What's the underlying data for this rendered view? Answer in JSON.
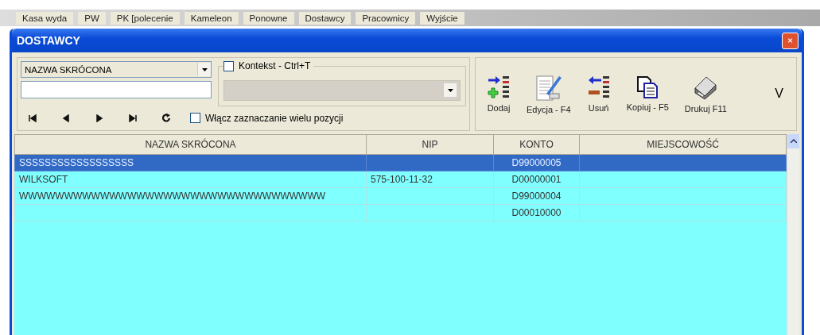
{
  "menu": [
    {
      "label": "Kasa wyda"
    },
    {
      "label": "PW"
    },
    {
      "label": "PK [polecenie"
    },
    {
      "label": "Kameleon"
    },
    {
      "label": "Ponowne"
    },
    {
      "label": "Dostawcy"
    },
    {
      "label": "Pracownicy"
    },
    {
      "label": "Wyjście"
    }
  ],
  "window": {
    "title": "DOSTAWCY"
  },
  "search": {
    "field_combo": "NAZWA SKRÓCONA"
  },
  "context": {
    "label": "Kontekst - Ctrl+T",
    "checked": false
  },
  "multi_select": {
    "label": "Włącz zaznaczanie wielu pozycji",
    "checked": false
  },
  "toolbar": [
    {
      "kind": "add",
      "label": "Dodaj"
    },
    {
      "kind": "edit",
      "label": "Edycja - F4"
    },
    {
      "kind": "delete",
      "label": "Usuń"
    },
    {
      "kind": "copy",
      "label": "Kopiuj - F5"
    },
    {
      "kind": "print",
      "label": "Drukuj F11"
    }
  ],
  "more_button": "V",
  "table": {
    "columns": [
      "NAZWA SKRÓCONA",
      "NIP",
      "KONTO",
      "MIEJSCOWOŚĆ"
    ],
    "rows": [
      {
        "cells": [
          "SSSSSSSSSSSSSSSSSS",
          "",
          "D99000005",
          ""
        ],
        "selected": true
      },
      {
        "cells": [
          "WILKSOFT",
          "575-100-11-32",
          "D00000001",
          ""
        ],
        "selected": false
      },
      {
        "cells": [
          "WWWWWWWWWWWWWWWWWWWWWWWWWWWWWWWWWW",
          "",
          "D99000004",
          ""
        ],
        "selected": false
      },
      {
        "cells": [
          "",
          "",
          "D00010000",
          ""
        ],
        "selected": false
      }
    ]
  }
}
